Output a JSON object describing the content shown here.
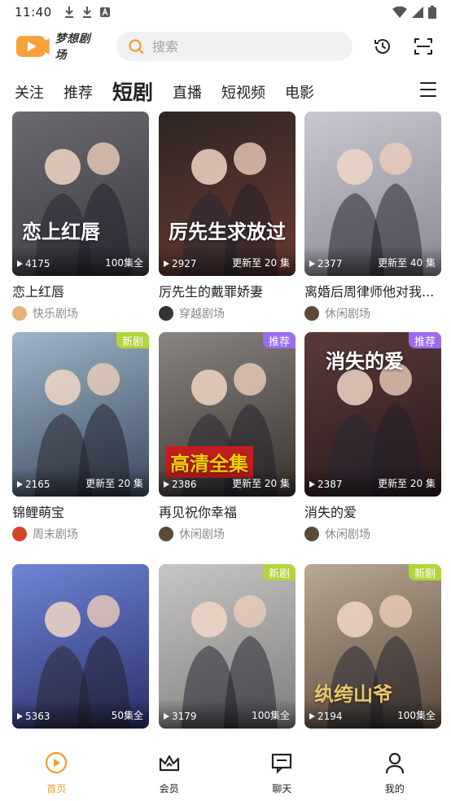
{
  "status_bar": {
    "time": "11:40"
  },
  "header": {
    "app_name": "梦想剧场",
    "search_placeholder": "搜索"
  },
  "tabs": [
    {
      "label": "关注",
      "active": false
    },
    {
      "label": "推荐",
      "active": false
    },
    {
      "label": "短剧",
      "active": true
    },
    {
      "label": "直播",
      "active": false
    },
    {
      "label": "短视频",
      "active": false
    },
    {
      "label": "电影",
      "active": false
    }
  ],
  "cards": [
    {
      "title": "恋上红唇",
      "plays": "4175",
      "episodes": "100集全",
      "badge": "",
      "source": "快乐剧场",
      "poster_text": "恋上红唇",
      "colors": [
        "#6c6a70",
        "#3d3b42"
      ]
    },
    {
      "title": "厉先生的戴罪娇妻",
      "plays": "2927",
      "episodes": "更新至 20 集",
      "badge": "",
      "source": "穿越剧场",
      "poster_text": "厉先生求放过",
      "colors": [
        "#2e2624",
        "#6a3a30"
      ]
    },
    {
      "title": "离婚后周律师他对我...",
      "plays": "2377",
      "episodes": "更新至 40 集",
      "badge": "",
      "source": "休闲剧场",
      "poster_text": "",
      "colors": [
        "#c9c7cf",
        "#8a8794"
      ]
    },
    {
      "title": "锦鲤萌宝",
      "plays": "2165",
      "episodes": "更新至 20 集",
      "badge": "新剧",
      "source": "周末剧场",
      "poster_text": "",
      "colors": [
        "#9fb6c9",
        "#3c4a5e"
      ]
    },
    {
      "title": "再见祝你幸福",
      "plays": "2386",
      "episodes": "更新至 20 集",
      "badge": "推荐",
      "source": "休闲剧场",
      "poster_text": "高清全集",
      "colors": [
        "#8a8580",
        "#3a3330"
      ]
    },
    {
      "title": "消失的爱",
      "plays": "2387",
      "episodes": "更新至 20 集",
      "badge": "推荐",
      "source": "休闲剧场",
      "poster_text": "消失的爱",
      "colors": [
        "#5a3a3a",
        "#2a1a1c"
      ]
    },
    {
      "title": "",
      "plays": "5363",
      "episodes": "50集全",
      "badge": "",
      "source": "",
      "poster_text": "",
      "colors": [
        "#6f86d6",
        "#2a2f6a"
      ]
    },
    {
      "title": "",
      "plays": "3179",
      "episodes": "100集全",
      "badge": "新剧",
      "source": "",
      "poster_text": "",
      "colors": [
        "#c7c6c4",
        "#7f7e7c"
      ]
    },
    {
      "title": "",
      "plays": "2194",
      "episodes": "100集全",
      "badge": "新剧",
      "source": "",
      "poster_text": "纨绔山爷",
      "colors": [
        "#b8a894",
        "#5b4a3b"
      ]
    }
  ],
  "bottom_nav": [
    {
      "label": "首页",
      "icon": "home-play-icon",
      "active": true
    },
    {
      "label": "会员",
      "icon": "crown-icon",
      "active": false
    },
    {
      "label": "聊天",
      "icon": "chat-icon",
      "active": false
    },
    {
      "label": "我的",
      "icon": "person-icon",
      "active": false
    }
  ],
  "accent_color": "#f39a2c"
}
